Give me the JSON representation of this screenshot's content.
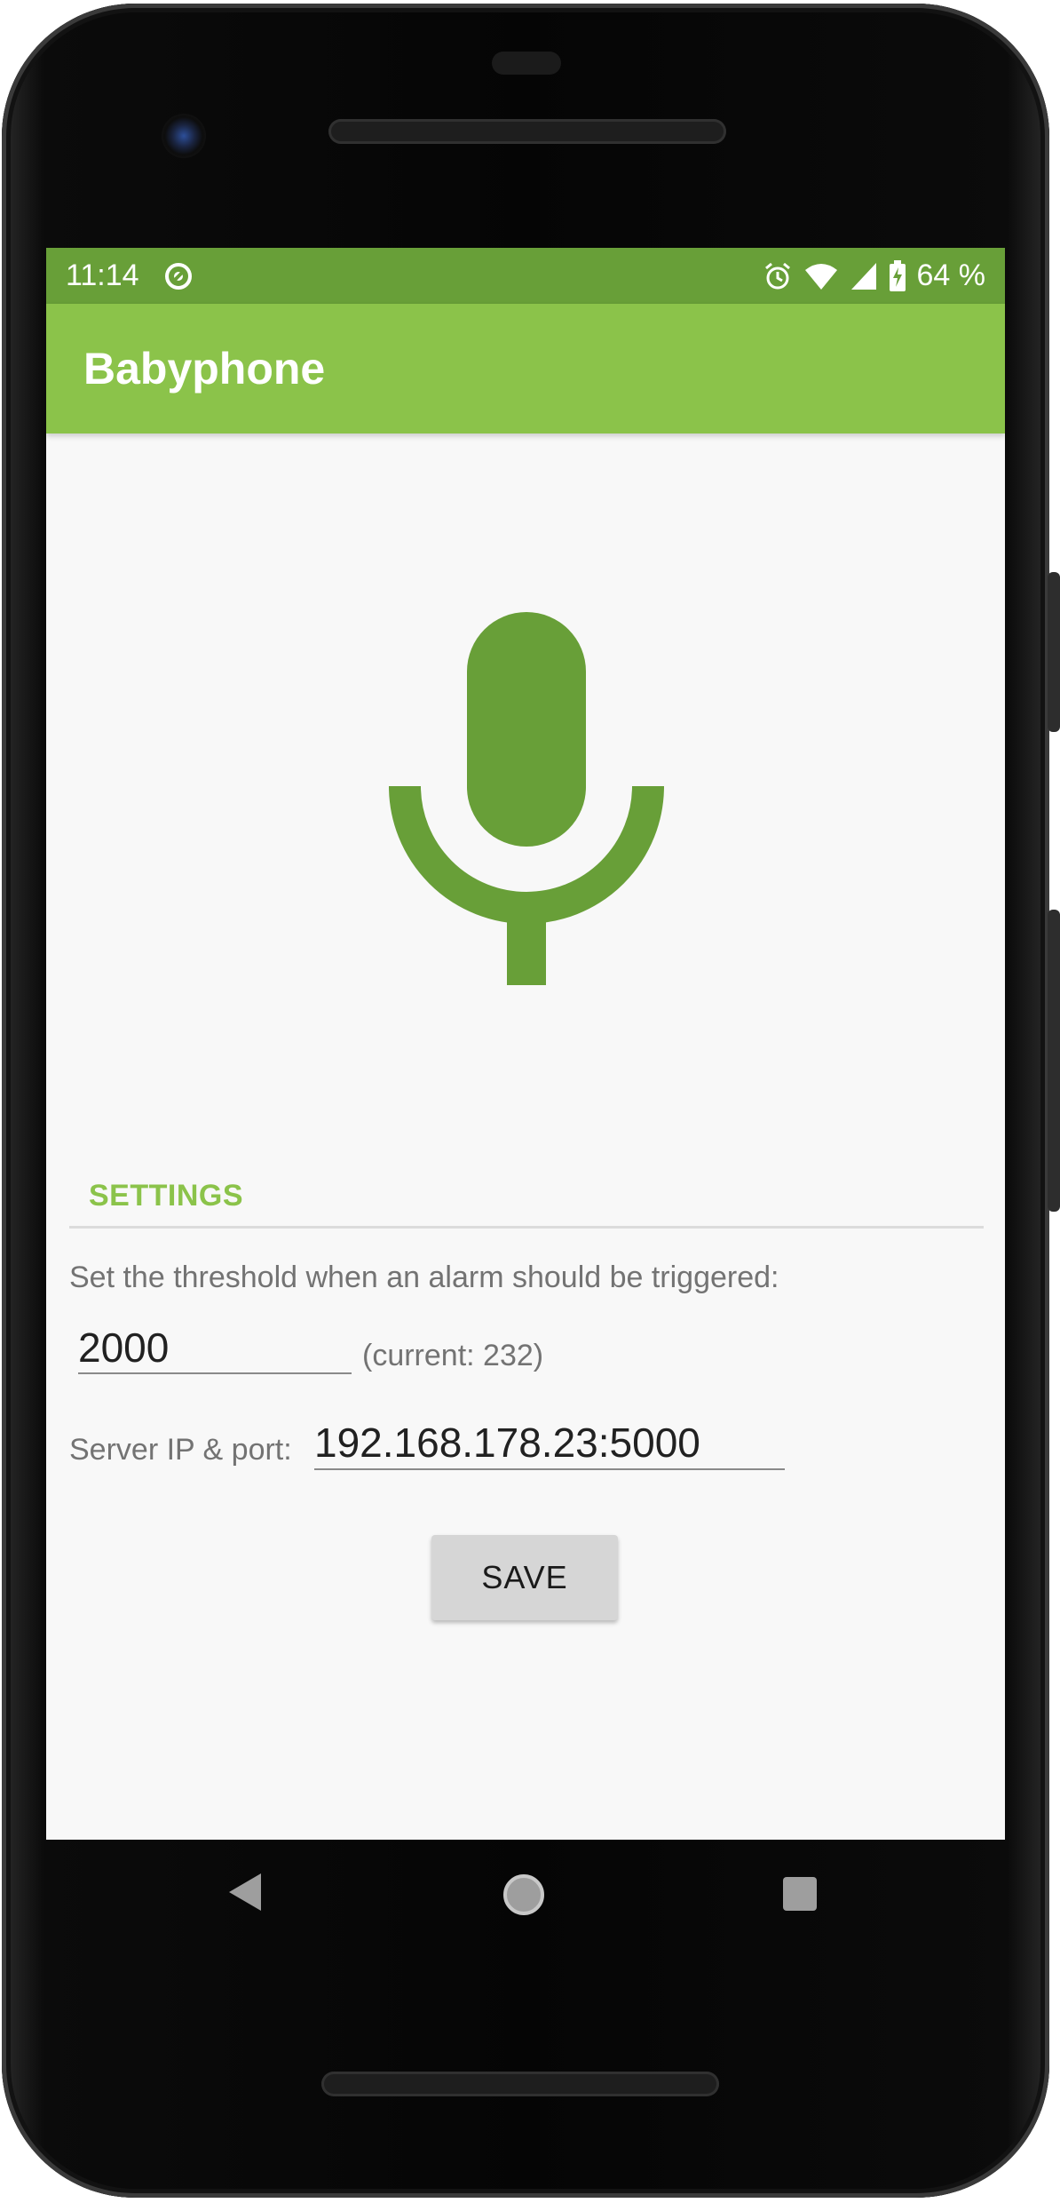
{
  "status_bar": {
    "time": "11:14",
    "battery": "64 %"
  },
  "app_bar": {
    "title": "Babyphone"
  },
  "main": {
    "mic_icon": "microphone-icon",
    "accent_color": "#689f38",
    "settings_header": "SETTINGS",
    "threshold_label": "Set the threshold when an alarm should be triggered:",
    "threshold_value": "2000",
    "current_level": "(current: 232)",
    "server_label": "Server IP & port:",
    "server_value": "192.168.178.23:5000",
    "save_label": "SAVE"
  },
  "nav": {
    "back": "back-icon",
    "home": "home-icon",
    "recents": "recents-icon"
  },
  "colors": {
    "status_bar": "#689f38",
    "app_bar": "#8bc34a",
    "background": "#f8f8f8"
  }
}
